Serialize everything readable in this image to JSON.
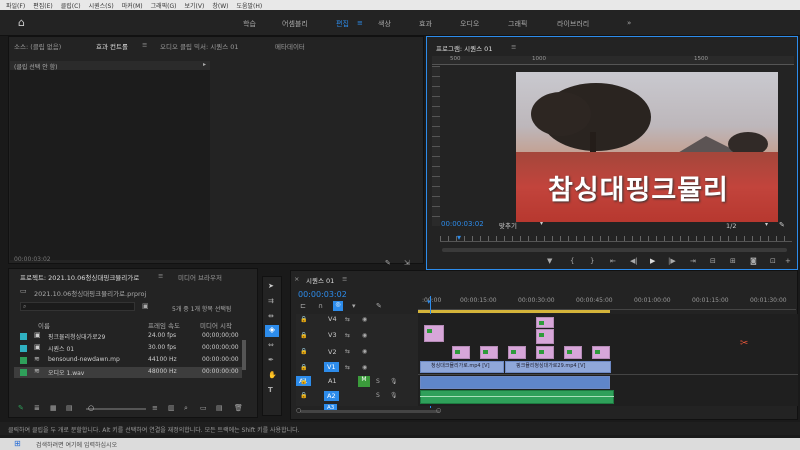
{
  "menubar": {
    "items": [
      "파일(F)",
      "편집(E)",
      "클립(C)",
      "시퀀스(S)",
      "마커(M)",
      "그래픽(G)",
      "보기(V)",
      "창(W)",
      "도움말(H)"
    ]
  },
  "workspaces": {
    "items": [
      "학습",
      "어셈블리",
      "편집",
      "색상",
      "효과",
      "오디오",
      "그래픽",
      "라이브러리"
    ],
    "active": "편집",
    "more": "»"
  },
  "source": {
    "tabs": [
      "소스: (클립 없음)",
      "효과 컨트롤",
      "오디오 클립 믹서: 시퀀스 01",
      "메타데이터"
    ],
    "active_tab": "효과 컨트롤",
    "no_clip": "(클립 선택 안 함)",
    "timecode": "00:00:03:02"
  },
  "program": {
    "title": "프로그램: 시퀀스 01",
    "ruler_marks": [
      "500",
      "1000",
      "1500"
    ],
    "overlay_text": "참싱대핑크뮬리",
    "timecode": "00:00:03:02",
    "fit": "맞추기",
    "resolution": "1/2"
  },
  "project": {
    "tab_active": "프로젝트: 2021.10.06청싱대핑크뮬리가로",
    "tab_other": "미디어 브라우저",
    "file": "2021.10.06청싱대핑크뮬리가로.prproj",
    "selection": "5개 중 1개 항목 선택됨",
    "columns": [
      "이름",
      "프레임 속도",
      "미디어 시작"
    ],
    "rows": [
      {
        "name": "핑크뮬리청싱대가로29",
        "rate": "24.00 fps",
        "start": "00;00;00;00",
        "color": "#2fb0c0"
      },
      {
        "name": "시퀀스 01",
        "rate": "30.00 fps",
        "start": "00;00;00;00",
        "color": "#2fb0c0"
      },
      {
        "name": "bensound-newdawn.mp",
        "rate": "44100 Hz",
        "start": "00:00:00:00",
        "color": "#2fa05a"
      },
      {
        "name": "오디오 1.wav",
        "rate": "48000 Hz",
        "start": "00:00:00:00",
        "color": "#2fa05a"
      }
    ]
  },
  "timeline": {
    "title": "시퀀스 01",
    "timecode": "00:00:03:02",
    "ruler": [
      ":00:00",
      "00:00:15:00",
      "00:00:30:00",
      "00:00:45:00",
      "00:01:00:00",
      "00:01:15:00",
      "00:01:30:00"
    ],
    "tracks": [
      "V4",
      "V3",
      "V2",
      "V1",
      "A1",
      "A2",
      "A3"
    ],
    "v1_clips": [
      "청싱대크뮬리가로.mp4 [V]",
      "핑크뮬리청싱대가로29.mp4 [V]"
    ]
  },
  "status": {
    "text": "클릭하여 클립을 두 개로 분할합니다. Alt 키를 선택하여 연결을 재정의합니다. 모든 트랙에는 Shift 키를 사용합니다."
  },
  "taskbar": {
    "search": "검색하려면 여기에 입력하십시오"
  }
}
